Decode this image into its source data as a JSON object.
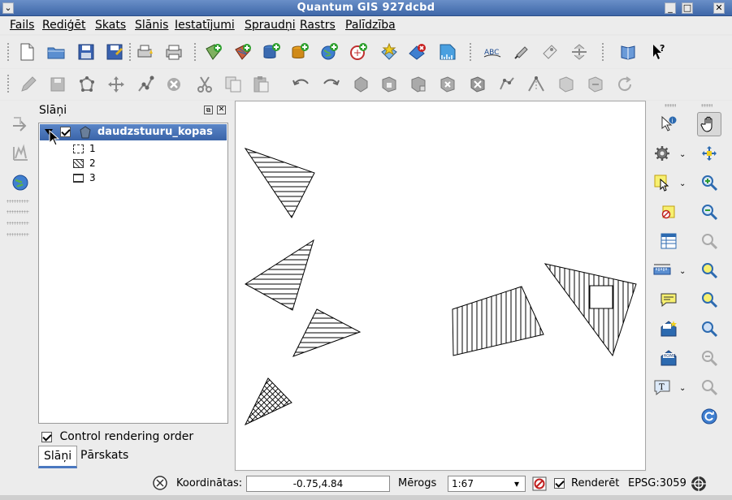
{
  "window": {
    "title": "Quantum GIS 927dcbd"
  },
  "menu": {
    "items": [
      "Fails",
      "Rediģēt",
      "Skats",
      "Slānis",
      "Iestatījumi",
      "Spraudņi",
      "Rastrs",
      "Palīdzība"
    ]
  },
  "toolbar_icons": {
    "row1": [
      "new-project-icon",
      "open-project-icon",
      "save-project-icon",
      "save-as-icon",
      "print-composer-icon",
      "print-icon",
      "add-vector-layer-icon",
      "add-raster-layer-icon",
      "add-postgis-layer-icon",
      "add-spatialite-layer-icon",
      "add-wms-layer-icon",
      "add-wfs-layer-icon",
      "new-vector-layer-icon",
      "remove-layer-icon",
      "add-grass-layer-icon",
      "label-icon",
      "pin-labels-icon",
      "show-hide-labels-icon",
      "move-label-icon",
      "help-contents-icon",
      "whats-this-icon"
    ],
    "row2": [
      "toggle-editing-icon",
      "save-edits-icon",
      "capture-polygon-icon",
      "move-feature-icon",
      "node-tool-icon",
      "delete-selected-icon",
      "cut-features-icon",
      "copy-features-icon",
      "paste-features-icon",
      "undo-icon",
      "redo-icon",
      "simplify-feature-icon",
      "add-ring-icon",
      "add-part-icon",
      "delete-ring-icon",
      "delete-part-icon",
      "reshape-icon",
      "split-features-icon",
      "merge-features-icon",
      "merge-attributes-icon",
      "rotate-symbol-icon"
    ]
  },
  "layers_panel": {
    "title": "Slāņi",
    "layer": {
      "name": "daudzstuuru_kopas",
      "visible": true,
      "expanded": true
    },
    "classes": [
      {
        "label": "1"
      },
      {
        "label": "2"
      },
      {
        "label": "3"
      }
    ],
    "control_rendering_order": {
      "label": "Control rendering order",
      "checked": true
    },
    "tabs": [
      {
        "label": "Slāņi",
        "active": true
      },
      {
        "label": "Pārskats",
        "active": false
      }
    ]
  },
  "status": {
    "coords_label": "Koordinātas:",
    "coords_value": "-0.75,4.84",
    "scale_label": "Mērogs",
    "scale_value": "1:67",
    "render_label": "Renderēt",
    "render_checked": true,
    "crs": "EPSG:3059"
  }
}
